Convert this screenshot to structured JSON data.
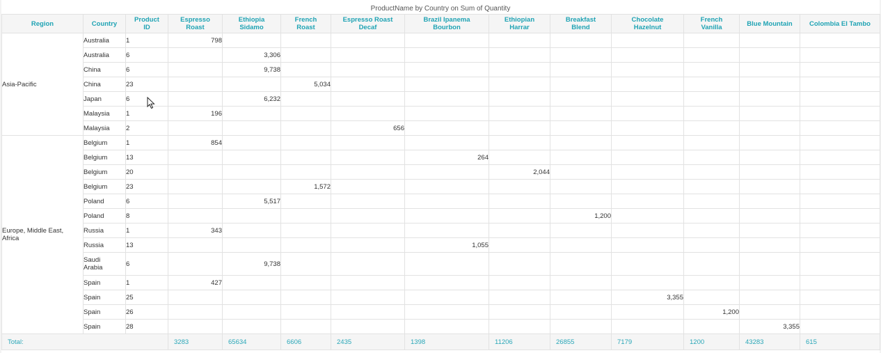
{
  "title": "ProductName by Country on Sum of Quantity",
  "headers": {
    "region": "Region",
    "country": "Country",
    "product_id": [
      "Product",
      "ID"
    ],
    "products": [
      [
        "Espresso",
        "Roast"
      ],
      [
        "Ethiopia",
        "Sidamo"
      ],
      [
        "French",
        "Roast"
      ],
      [
        "Espresso Roast",
        "Decaf"
      ],
      [
        "Brazil Ipanema",
        "Bourbon"
      ],
      [
        "Ethiopian",
        "Harrar"
      ],
      [
        "Breakfast",
        "Blend"
      ],
      [
        "Chocolate",
        "Hazelnut"
      ],
      [
        "French",
        "Vanilla"
      ],
      [
        "Blue Mountain"
      ],
      [
        "Colombia El Tambo"
      ]
    ]
  },
  "regions": [
    {
      "label": [
        "Asia-Pacific"
      ],
      "rows": [
        {
          "country": [
            "Australia"
          ],
          "id": "1",
          "col": 0,
          "value": "798"
        },
        {
          "country": [
            "Australia"
          ],
          "id": "6",
          "col": 1,
          "value": "3,306"
        },
        {
          "country": [
            "China"
          ],
          "id": "6",
          "col": 1,
          "value": "9,738"
        },
        {
          "country": [
            "China"
          ],
          "id": "23",
          "col": 2,
          "value": "5,034"
        },
        {
          "country": [
            "Japan"
          ],
          "id": "6",
          "col": 1,
          "value": "6,232"
        },
        {
          "country": [
            "Malaysia"
          ],
          "id": "1",
          "col": 0,
          "value": "196"
        },
        {
          "country": [
            "Malaysia"
          ],
          "id": "2",
          "col": 3,
          "value": "656"
        }
      ]
    },
    {
      "label": [
        "Europe, Middle East,",
        "Africa"
      ],
      "rows": [
        {
          "country": [
            "Belgium"
          ],
          "id": "1",
          "col": 0,
          "value": "854"
        },
        {
          "country": [
            "Belgium"
          ],
          "id": "13",
          "col": 4,
          "value": "264"
        },
        {
          "country": [
            "Belgium"
          ],
          "id": "20",
          "col": 5,
          "value": "2,044"
        },
        {
          "country": [
            "Belgium"
          ],
          "id": "23",
          "col": 2,
          "value": "1,572"
        },
        {
          "country": [
            "Poland"
          ],
          "id": "6",
          "col": 1,
          "value": "5,517"
        },
        {
          "country": [
            "Poland"
          ],
          "id": "8",
          "col": 6,
          "value": "1,200"
        },
        {
          "country": [
            "Russia"
          ],
          "id": "1",
          "col": 0,
          "value": "343"
        },
        {
          "country": [
            "Russia"
          ],
          "id": "13",
          "col": 4,
          "value": "1,055"
        },
        {
          "country": [
            "Saudi",
            "Arabia"
          ],
          "id": "6",
          "col": 1,
          "value": "9,738"
        },
        {
          "country": [
            "Spain"
          ],
          "id": "1",
          "col": 0,
          "value": "427"
        },
        {
          "country": [
            "Spain"
          ],
          "id": "25",
          "col": 7,
          "value": "3,355"
        },
        {
          "country": [
            "Spain"
          ],
          "id": "26",
          "col": 8,
          "value": "1,200"
        },
        {
          "country": [
            "Spain"
          ],
          "id": "28",
          "col": 9,
          "value": "3,355"
        }
      ]
    }
  ],
  "total": {
    "label": "Total:",
    "values": [
      "3283",
      "65634",
      "6606",
      "2435",
      "1398",
      "11206",
      "26855",
      "7179",
      "1200",
      "43283",
      "615"
    ]
  },
  "colors": {
    "accent": "#1fa3b4",
    "header_bg": "#f5f5f5",
    "grid": "#e2e2e2"
  },
  "cursor_icon": "mouse-pointer-icon"
}
